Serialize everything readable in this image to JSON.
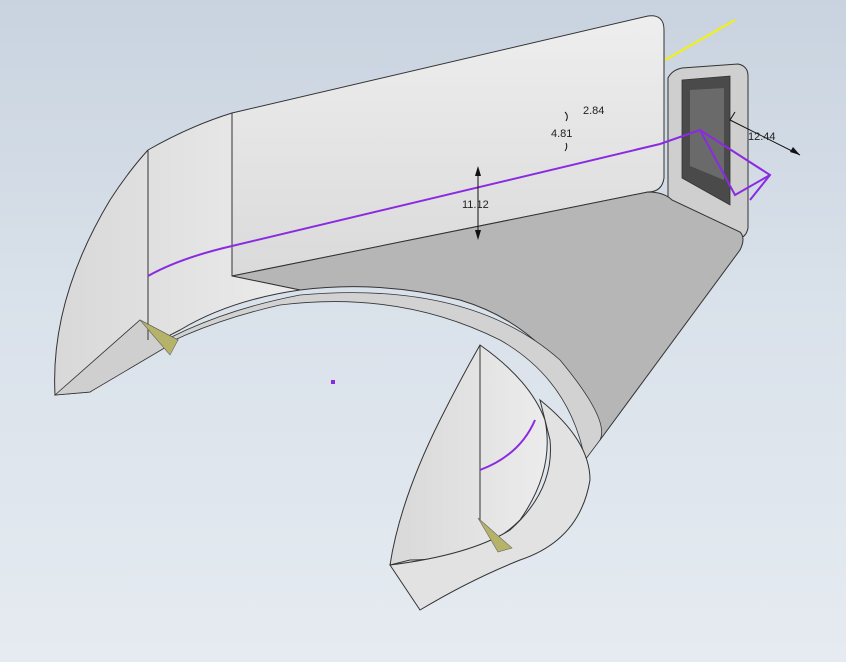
{
  "viewport": {
    "background_top": "#c9d3df",
    "background_bottom": "#e6ebf1"
  },
  "colors": {
    "sketch_line": "#8a2be2",
    "selection_line": "#f2f20a",
    "part_face": "#e4e4e4",
    "part_shadow": "#b8b8b8",
    "edge": "#333333",
    "dimension": "#111111"
  },
  "dimensions": {
    "d1": "2.84",
    "d2": "4.81",
    "d3": "11.12",
    "d4": "12.44"
  }
}
